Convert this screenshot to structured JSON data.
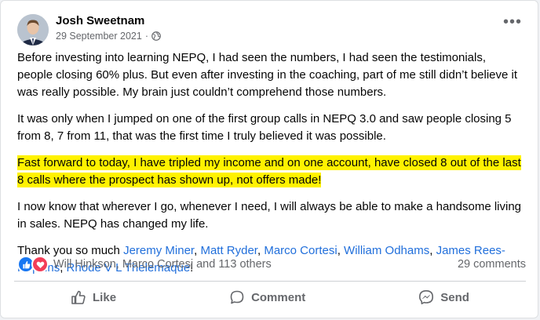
{
  "post": {
    "author": "Josh Sweetnam",
    "date": "29 September 2021",
    "separator": "·",
    "more_label": "•••",
    "paragraphs": {
      "p1": "Before investing into learning NEPQ, I had seen the numbers, I had seen the testimonials, people closing 60% plus. But even after investing in the coaching, part of me still didn’t believe it was really possible. My brain just couldn’t comprehend those numbers.",
      "p2": "It was only when I jumped on one of the first group calls in NEPQ 3.0 and saw people closing 5 from 8, 7 from 11, that was the first time I truly believed it was possible.",
      "p3": "Fast forward to today, I have tripled my income and on one account, have closed 8 out of the last 8 calls where the prospect has shown up, not offers made!",
      "p4": "I now know that wherever I go, whenever I need, I will always be able to make a handsome living in sales. NEPQ has changed my life."
    },
    "thanks": {
      "prefix": "Thank you so much ",
      "mentions": [
        "Jeremy Miner",
        "Matt Ryder",
        "Marco Cortesi",
        "William Odhams",
        "James Rees-Hopkins",
        "Rhode V L Thelemaque"
      ],
      "sep": ", ",
      "suffix": "!"
    },
    "highlight_color": "#fff200",
    "mention_color": "#216fdb"
  },
  "engagement": {
    "reaction_icons": [
      "like-reaction-icon",
      "love-reaction-icon"
    ],
    "reactors_text": "Will Hinkson, Marco Cortesi and 113 others",
    "comments_text": "29 comments"
  },
  "actions": {
    "like": "Like",
    "comment": "Comment",
    "send": "Send"
  }
}
